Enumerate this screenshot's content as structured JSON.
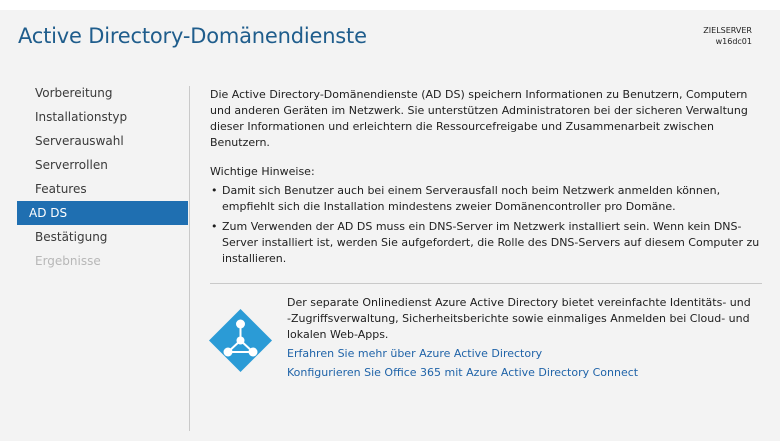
{
  "window": {
    "title": "Active Directory-Domänendienste"
  },
  "server": {
    "label": "ZIELSERVER",
    "name": "w16dc01"
  },
  "nav": {
    "items": [
      {
        "label": "Vorbereitung"
      },
      {
        "label": "Installationstyp"
      },
      {
        "label": "Serverauswahl"
      },
      {
        "label": "Serverrollen"
      },
      {
        "label": "Features"
      },
      {
        "label": "AD DS"
      },
      {
        "label": "Bestätigung"
      },
      {
        "label": "Ergebnisse"
      }
    ],
    "active": "AD DS",
    "disabled": [
      "Ergebnisse"
    ]
  },
  "content": {
    "intro": "Die Active Directory-Domänendienste (AD DS) speichern Informationen zu Benutzern, Computern und anderen Geräten im Netzwerk. Sie unterstützen Administratoren bei der sicheren Verwaltung dieser Informationen und erleichtern die Ressourcefreigabe und Zusammenarbeit zwischen Benutzern.",
    "notes_heading": "Wichtige Hinweise:",
    "notes": [
      "Damit sich Benutzer auch bei einem Serverausfall noch beim Netzwerk anmelden können, empfiehlt sich die Installation mindestens zweier Domänencontroller pro Domäne.",
      "Zum Verwenden der AD DS muss ein DNS-Server im Netzwerk installiert sein. Wenn kein DNS-Server installiert ist, werden Sie aufgefordert, die Rolle des DNS-Servers auf diesem Computer zu installieren."
    ]
  },
  "azure": {
    "icon": "azure-active-directory-icon",
    "description": "Der separate Onlinedienst Azure Active Directory bietet vereinfachte Identitäts- und -Zugriffsverwaltung, Sicherheitsberichte sowie einmaliges Anmelden bei Cloud- und lokalen Web-Apps.",
    "link_learn_more": "Erfahren Sie mehr über Azure Active Directory",
    "link_configure": "Konfigurieren Sie Office 365 mit Azure Active Directory Connect"
  },
  "colors": {
    "accent": "#1f6fb1",
    "title": "#1f5d8c",
    "link": "#1f63a8",
    "background": "#f3f3f3",
    "azure_icon": "#2b9bd6"
  }
}
